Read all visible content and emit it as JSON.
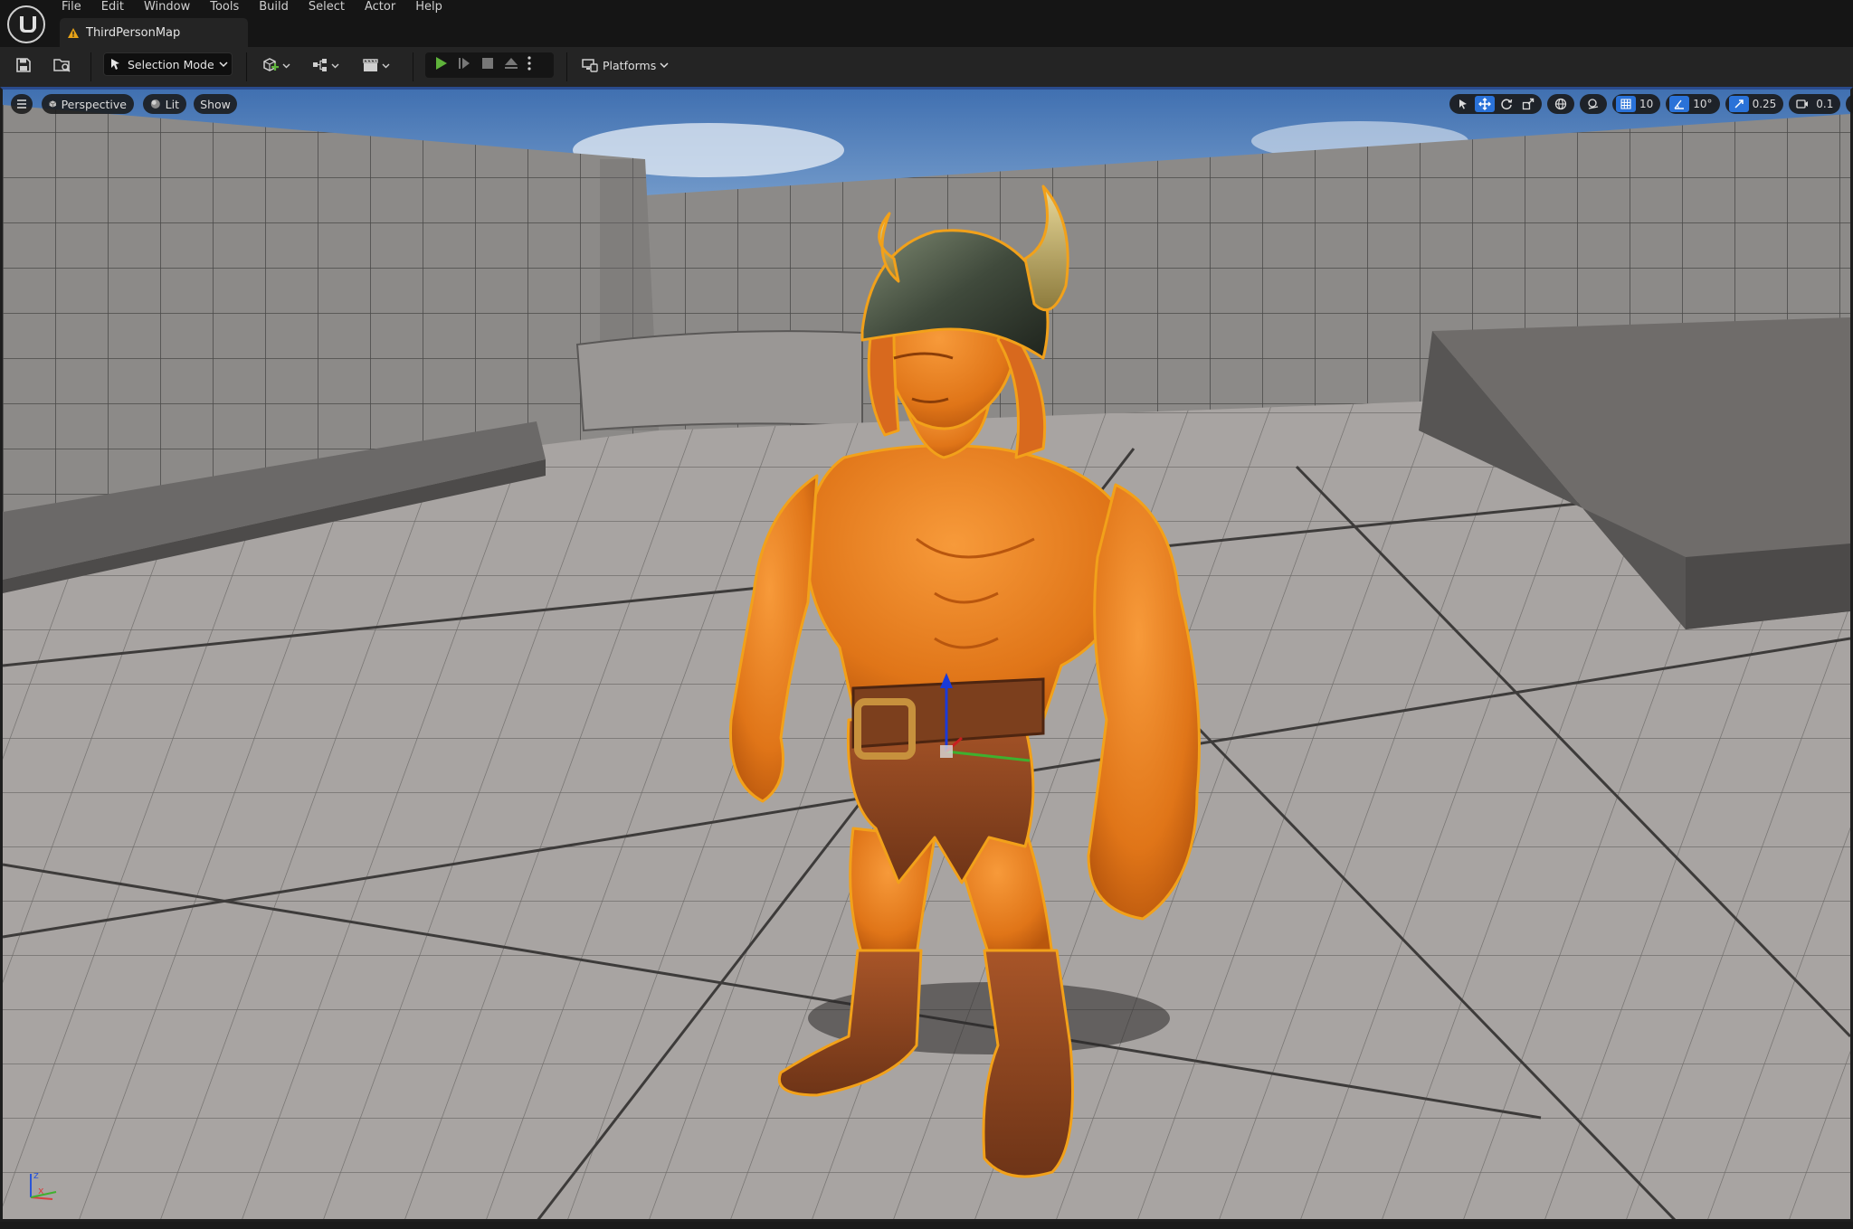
{
  "app": {
    "menu": [
      "File",
      "Edit",
      "Window",
      "Tools",
      "Build",
      "Select",
      "Actor",
      "Help"
    ],
    "tab_title": "ThirdPersonMap"
  },
  "toolbar": {
    "selection_mode": "Selection Mode",
    "platforms": "Platforms"
  },
  "viewport": {
    "menu_icon": "hamburger-icon",
    "view_mode": "Perspective",
    "lighting_mode": "Lit",
    "show_label": "Show",
    "grid_snap": "10",
    "rotation_snap": "10°",
    "scale_snap": "0.25",
    "camera_speed": "0.1",
    "axis_labels": [
      "z",
      "x"
    ]
  },
  "colors": {
    "accent": "#2a72d8",
    "play_green": "#5fb33b",
    "selection_outline": "#f2a11a",
    "warning_icon": "#e8a317"
  }
}
